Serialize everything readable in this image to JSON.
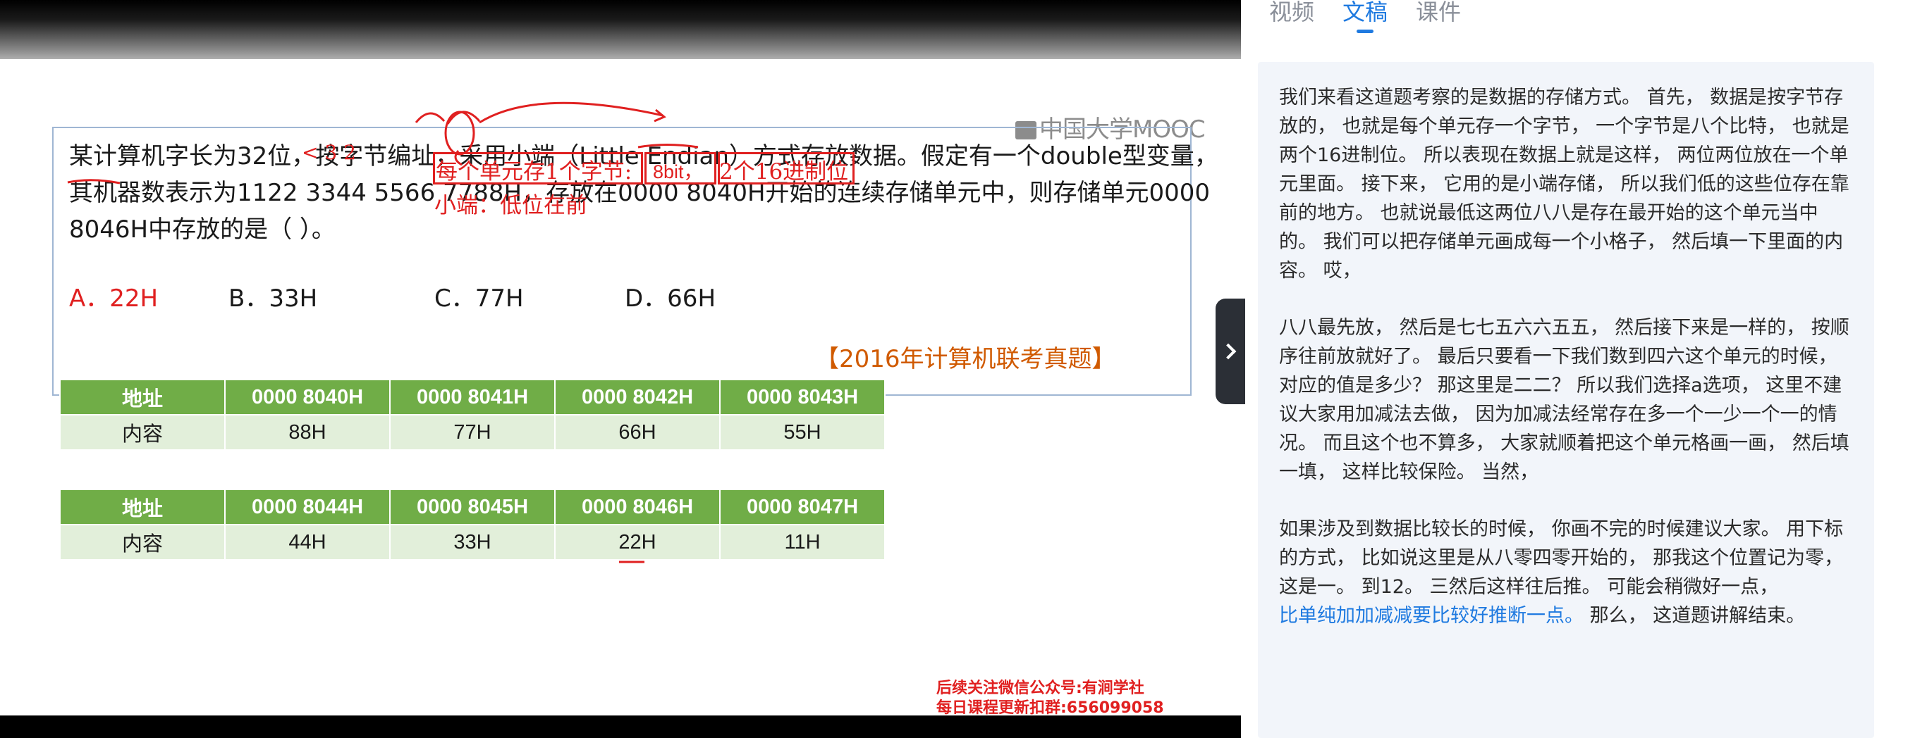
{
  "watermark": "中国大学MOOC",
  "question": {
    "line1": "某计算机字长为32位，按字节编址，采用小端（Little Endian）方式存放数据。假定有一个double型变量，",
    "line2": "其机器数表示为1122 3344 5566 7788H，存放在0000 8040H开始的连续存储单元中，则存储单元0000",
    "line3": "8046H中存放的是（      ）。",
    "options": [
      {
        "label": "A．22H",
        "correct": true
      },
      {
        "label": "B．33H",
        "correct": false
      },
      {
        "label": "C．77H",
        "correct": false
      },
      {
        "label": "D．66H",
        "correct": false
      }
    ],
    "source": "【2016年计算机联考真题】"
  },
  "annotations": {
    "box1": "每个单元存1个字节:",
    "box2": "8bit，",
    "box3": "2个16进制位",
    "note": "小端：低位在前",
    "marks": "<  3  2"
  },
  "tables": [
    {
      "header_label": "地址",
      "value_label": "内容",
      "addresses": [
        "0000 8040H",
        "0000 8041H",
        "0000 8042H",
        "0000 8043H"
      ],
      "values": [
        "88H",
        "77H",
        "66H",
        "55H"
      ]
    },
    {
      "header_label": "地址",
      "value_label": "内容",
      "addresses": [
        "0000 8044H",
        "0000 8045H",
        "0000 8046H",
        "0000 8047H"
      ],
      "values": [
        "44H",
        "33H",
        "22H",
        "11H"
      ]
    }
  ],
  "wechat_note": {
    "line1": "后续关注微信公众号:有涧学社",
    "line2": "每日课程更新扣群:656099058"
  },
  "tabs": [
    {
      "label": "视频",
      "active": false
    },
    {
      "label": "文稿",
      "active": true
    },
    {
      "label": "课件",
      "active": false
    }
  ],
  "transcript": {
    "p1": "我们来看这道题考察的是数据的存储方式。 首先， 数据是按字节存放的， 也就是每个单元存一个字节， 一个字节是八个比特， 也就是两个16进制位。 所以表现在数据上就是这样， 两位两位放在一个单元里面。 接下来， 它用的是小端存储， 所以我们低的这些位存在靠前的地方。 也就说最低这两位八八是存在最开始的这个单元当中的。 我们可以把存储单元画成每一个小格子， 然后填一下里面的内容。 哎，",
    "p2": "八八最先放， 然后是七七五六六五五， 然后接下来是一样的， 按顺序往前放就好了。 最后只要看一下我们数到四六这个单元的时候， 对应的值是多少？ 那这里是二二？ 所以我们选择a选项， 这里不建议大家用加减法去做， 因为加减法经常存在多一个一少一个一的情况。 而且这个也不算多， 大家就顺着把这个单元格画一画， 然后填一填， 这样比较保险。 当然，",
    "p3_plain": "如果涉及到数据比较长的时候， 你画不完的时候建议大家。 用下标的方式， 比如说这里是从八零四零开始的， 那我这个位置记为零， 这是一。 到12。 三然后这样往后推。 可能会稍微好一点，",
    "p3_highlight": "比单纯加加减减要比较好推断一点。",
    "p3_tail": " 那么， 这道题讲解结束。"
  },
  "colors": {
    "accent": "#1f7ae0",
    "table_header": "#70ad47",
    "table_row": "#e2efda",
    "annotation_red": "#e02020"
  }
}
